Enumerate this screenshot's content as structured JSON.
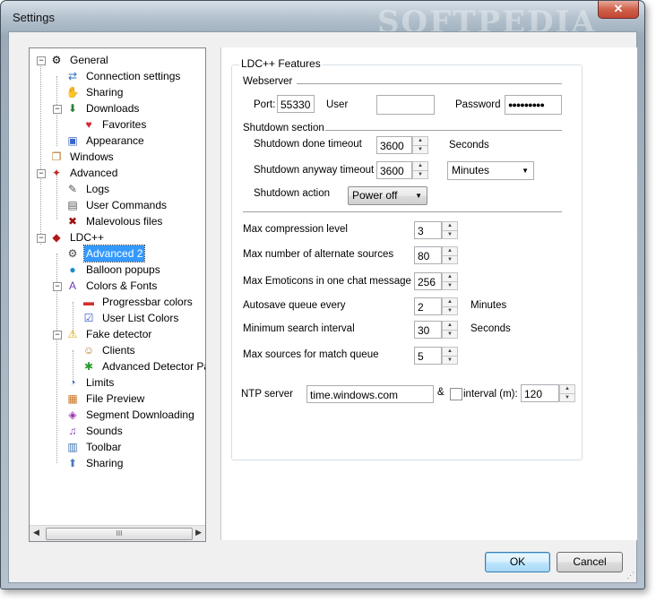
{
  "window": {
    "title": "Settings",
    "watermark": "SOFTPEDIA",
    "close_glyph": "✕"
  },
  "tree": {
    "items": [
      {
        "label": "General",
        "icon": "general-icon"
      },
      {
        "label": "Connection settings",
        "icon": "connection-icon"
      },
      {
        "label": "Sharing",
        "icon": "sharing-icon"
      },
      {
        "label": "Downloads",
        "icon": "downloads-icon"
      },
      {
        "label": "Favorites",
        "icon": "favorites-icon"
      },
      {
        "label": "Appearance",
        "icon": "appearance-icon"
      },
      {
        "label": "Windows",
        "icon": "windows-icon"
      },
      {
        "label": "Advanced",
        "icon": "advanced-icon"
      },
      {
        "label": "Logs",
        "icon": "logs-icon"
      },
      {
        "label": "User Commands",
        "icon": "user-commands-icon"
      },
      {
        "label": "Malevolous files",
        "icon": "malevolous-files-icon"
      },
      {
        "label": "LDC++",
        "icon": "ldc-icon"
      },
      {
        "label": "Advanced 2",
        "icon": "advanced2-icon",
        "selected": true
      },
      {
        "label": "Balloon popups",
        "icon": "balloon-icon"
      },
      {
        "label": "Colors & Fonts",
        "icon": "colors-fonts-icon"
      },
      {
        "label": "Progressbar colors",
        "icon": "progressbar-icon"
      },
      {
        "label": "User List Colors",
        "icon": "user-list-colors-icon"
      },
      {
        "label": "Fake detector",
        "icon": "warning-icon"
      },
      {
        "label": "Clients",
        "icon": "clients-icon"
      },
      {
        "label": "Advanced Detector Pa",
        "icon": "detector-icon"
      },
      {
        "label": "Limits",
        "icon": "limits-icon"
      },
      {
        "label": "File Preview",
        "icon": "file-preview-icon"
      },
      {
        "label": "Segment Downloading",
        "icon": "segment-icon"
      },
      {
        "label": "Sounds",
        "icon": "sounds-icon"
      },
      {
        "label": "Toolbar",
        "icon": "toolbar-icon"
      },
      {
        "label": "Sharing",
        "icon": "sharing2-icon"
      }
    ],
    "scroll_grip": "III"
  },
  "features": {
    "legend": "LDC++ Features",
    "webserver": {
      "title": "Webserver",
      "port_label": "Port:",
      "port_value": "55330",
      "user_label": "User",
      "user_value": "",
      "password_label": "Password",
      "password_value": "●●●●●●●●●"
    },
    "shutdown": {
      "title": "Shutdown section",
      "done_timeout_label": "Shutdown done timeout",
      "done_timeout_value": "3600",
      "done_timeout_unit": "Seconds",
      "anyway_timeout_label": "Shutdown anyway timeout",
      "anyway_timeout_value": "3600",
      "anyway_timeout_unit": "Minutes",
      "action_label": "Shutdown action",
      "action_value": "Power off"
    },
    "settings": [
      {
        "label": "Max compression level",
        "value": "3",
        "unit": ""
      },
      {
        "label": "Max number of alternate sources",
        "value": "80",
        "unit": ""
      },
      {
        "label": "Max Emoticons in one chat message",
        "value": "256",
        "unit": ""
      },
      {
        "label": "Autosave queue every",
        "value": "2",
        "unit": "Minutes"
      },
      {
        "label": "Minimum search interval",
        "value": "30",
        "unit": "Seconds"
      },
      {
        "label": "Max sources for match queue",
        "value": "5",
        "unit": ""
      }
    ],
    "ntp": {
      "label": "NTP server",
      "value": "time.windows.com",
      "amp": "&",
      "interval_label": "interval (m):",
      "interval_checked": false,
      "interval_value": "120"
    }
  },
  "buttons": {
    "ok": "OK",
    "cancel": "Cancel"
  },
  "colors": {
    "selection": "#3399ff",
    "close": "#c24632"
  }
}
